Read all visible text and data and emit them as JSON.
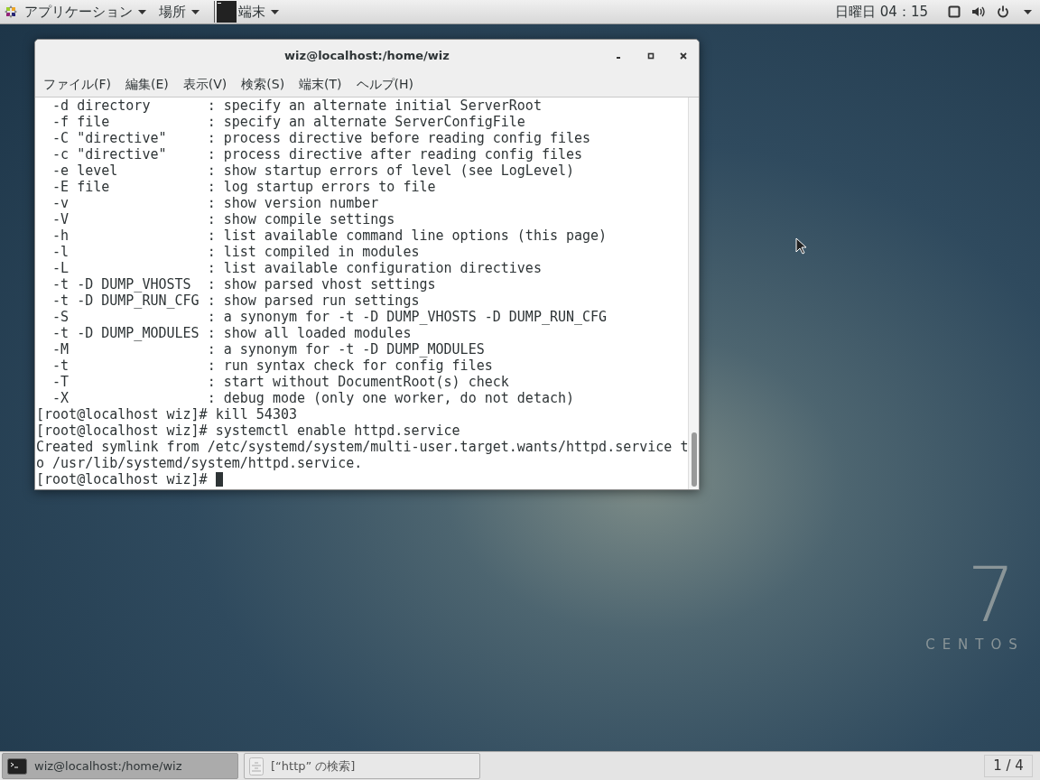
{
  "top_bar": {
    "applications": "アプリケーション",
    "places": "場所",
    "active_app": "端末",
    "clock": "日曜日 04：15"
  },
  "window": {
    "title": "wiz@localhost:/home/wiz",
    "menu": [
      "ファイル(F)",
      "編集(E)",
      "表示(V)",
      "検索(S)",
      "端末(T)",
      "ヘルプ(H)"
    ],
    "lines": [
      "  -d directory       : specify an alternate initial ServerRoot",
      "  -f file            : specify an alternate ServerConfigFile",
      "  -C \"directive\"     : process directive before reading config files",
      "  -c \"directive\"     : process directive after reading config files",
      "  -e level           : show startup errors of level (see LogLevel)",
      "  -E file            : log startup errors to file",
      "  -v                 : show version number",
      "  -V                 : show compile settings",
      "  -h                 : list available command line options (this page)",
      "  -l                 : list compiled in modules",
      "  -L                 : list available configuration directives",
      "  -t -D DUMP_VHOSTS  : show parsed vhost settings",
      "  -t -D DUMP_RUN_CFG : show parsed run settings",
      "  -S                 : a synonym for -t -D DUMP_VHOSTS -D DUMP_RUN_CFG",
      "  -t -D DUMP_MODULES : show all loaded modules",
      "  -M                 : a synonym for -t -D DUMP_MODULES",
      "  -t                 : run syntax check for config files",
      "  -T                 : start without DocumentRoot(s) check",
      "  -X                 : debug mode (only one worker, do not detach)",
      "[root@localhost wiz]# kill 54303",
      "[root@localhost wiz]# systemctl enable httpd.service",
      "Created symlink from /etc/systemd/system/multi-user.target.wants/httpd.service t",
      "o /usr/lib/systemd/system/httpd.service."
    ],
    "prompt": "[root@localhost wiz]# "
  },
  "desktop_logo": {
    "number": "7",
    "name": "CENTOS"
  },
  "taskbar": {
    "items": [
      {
        "label": "wiz@localhost:/home/wiz",
        "selected": true,
        "kind": "terminal"
      },
      {
        "label": "[“http” の検索]",
        "selected": false,
        "kind": "files"
      }
    ],
    "workspace": "1 / 4"
  }
}
